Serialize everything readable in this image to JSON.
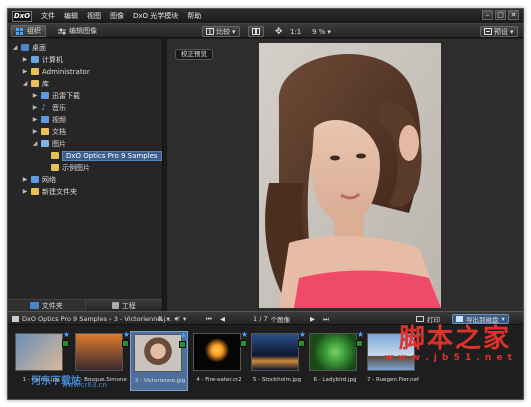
{
  "app": {
    "logo": "DxO",
    "menu": [
      "文件",
      "编辑",
      "视图",
      "图像",
      "DxO 光学模块",
      "帮助"
    ]
  },
  "toolbar": {
    "tab_organize": "组织",
    "tab_edit": "编辑图像",
    "compare": "比较",
    "zoom_fit": "1:1",
    "zoom_level": "9 %",
    "preset": "预设"
  },
  "tree": {
    "desktop": "桌面",
    "computer": "计算机",
    "administrator": "Administrator",
    "library": "库",
    "downloads": "迅雷下载",
    "music": "音乐",
    "videos": "视频",
    "documents": "文档",
    "pictures": "图片",
    "samples": "DxO Optics Pro 9 Samples",
    "example_pictures": "示例图片",
    "network": "网络",
    "new_folder": "新建文件夹"
  },
  "left_bottom": {
    "folders": "文件夹",
    "projects": "工程"
  },
  "viewer": {
    "preview_button": "校正预览"
  },
  "strip": {
    "breadcrumb": "DxO Optics Pro 9 Samples › 3 - Victorienne.j...",
    "page": "1 / 7",
    "page_label": "个图像",
    "print": "打印",
    "export": "导出到磁盘"
  },
  "thumbnails": [
    {
      "caption": "1 - Helmo.jpg",
      "colors": [
        "#6a8fb8",
        "#d9b89a"
      ]
    },
    {
      "caption": "2 - Bosque.Simone",
      "colors": [
        "#e07a2a",
        "#3a2a30"
      ]
    },
    {
      "caption": "3 - Victorienne.jpg",
      "colors": [
        "#c9c3bd",
        "#6b4a3a"
      ]
    },
    {
      "caption": "4 - Fire-eater.cr2",
      "colors": [
        "#ff9a20",
        "#050505"
      ]
    },
    {
      "caption": "5 - Stockholm.jpg",
      "colors": [
        "#2c4f8a",
        "#0e1830"
      ]
    },
    {
      "caption": "6 - Ladybird.jpg",
      "colors": [
        "#3fa03a",
        "#1a4a18"
      ]
    },
    {
      "caption": "7 - Ruegen Pier.nef",
      "colors": [
        "#7aa6d6",
        "#c8dcef"
      ]
    }
  ],
  "watermark": {
    "line1": "脚本之家",
    "line2": "w w w . j b 5 1 . n e t",
    "site_a": "河东下载站",
    "site_b": "www.cr63.cn"
  }
}
